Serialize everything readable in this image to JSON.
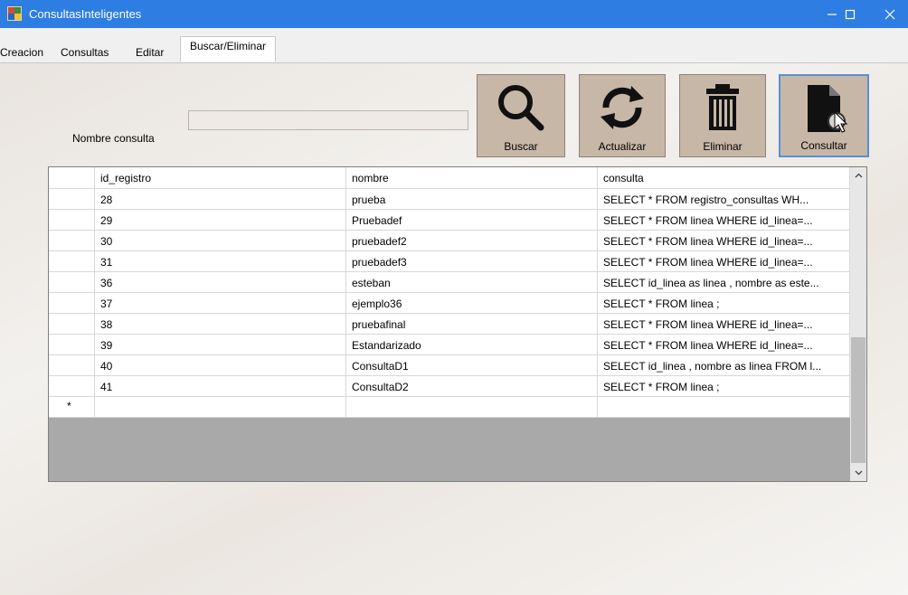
{
  "window": {
    "title": "ConsultasInteligentes",
    "minimize_icon": "minimize-icon",
    "maximize_icon": "maximize-icon",
    "close_icon": "close-icon"
  },
  "tabs": [
    {
      "label": "Creacion"
    },
    {
      "label": "Consultas"
    },
    {
      "label": "Editar"
    },
    {
      "label": "Buscar/Eliminar",
      "active": true
    }
  ],
  "form": {
    "name_label": "Nombre consulta",
    "name_value": ""
  },
  "toolbar": [
    {
      "label": "Buscar",
      "icon": "search-icon"
    },
    {
      "label": "Actualizar",
      "icon": "refresh-icon"
    },
    {
      "label": "Eliminar",
      "icon": "trash-icon"
    },
    {
      "label": "Consultar",
      "icon": "document-search-icon"
    }
  ],
  "grid": {
    "columns": [
      "id_registro",
      "nombre",
      "consulta"
    ],
    "rows": [
      [
        "28",
        "prueba",
        "SELECT  * FROM registro_consultas  WH..."
      ],
      [
        "29",
        "Pruebadef",
        "SELECT  * FROM linea  WHERE id_linea=..."
      ],
      [
        "30",
        "pruebadef2",
        "SELECT  * FROM linea  WHERE id_linea=..."
      ],
      [
        "31",
        "pruebadef3",
        "SELECT  * FROM linea  WHERE id_linea=..."
      ],
      [
        "36",
        "esteban",
        "SELECT id_linea as linea , nombre as este..."
      ],
      [
        "37",
        "ejemplo36",
        "SELECT  * FROM linea   ;"
      ],
      [
        "38",
        "pruebafinal",
        "SELECT  * FROM linea  WHERE id_linea=..."
      ],
      [
        "39",
        "Estandarizado",
        "SELECT  * FROM linea  WHERE id_linea=..."
      ],
      [
        "40",
        "ConsultaD1",
        "SELECT id_linea , nombre as linea FROM l..."
      ],
      [
        "41",
        "ConsultaD2",
        "SELECT  * FROM linea   ;"
      ]
    ],
    "new_row_marker": "*"
  },
  "colors": {
    "titlebar": "#2d7de3",
    "button_face": "#c7b7a7"
  }
}
